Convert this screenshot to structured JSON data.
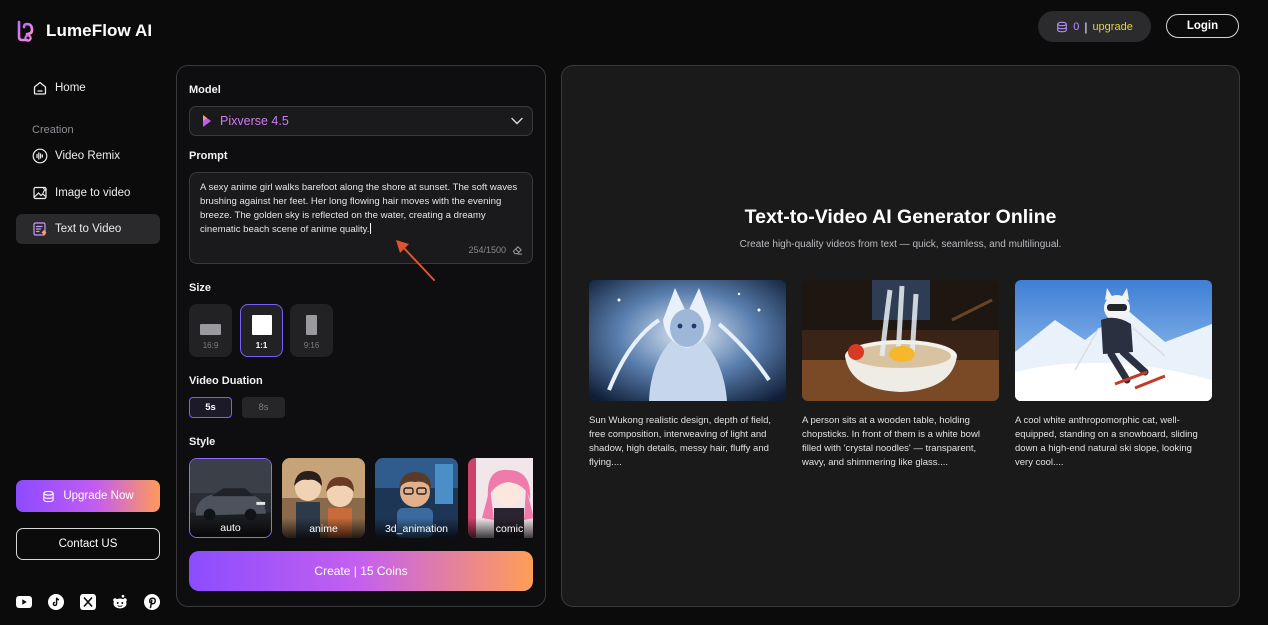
{
  "brand": {
    "name": "LumeFlow AI"
  },
  "sidebar": {
    "home": "Home",
    "section_label": "Creation",
    "items": [
      {
        "label": "Video Remix",
        "icon": "waveform-icon"
      },
      {
        "label": "Image to video",
        "icon": "image-icon"
      },
      {
        "label": "Text to Video",
        "icon": "text-document-icon",
        "active": true
      }
    ],
    "upgrade_now": "Upgrade Now",
    "contact_us": "Contact US",
    "socials": [
      "youtube-icon",
      "tiktok-icon",
      "x-icon",
      "reddit-icon",
      "pinterest-icon"
    ]
  },
  "topbar": {
    "coins": "0",
    "separator": "|",
    "upgrade": "upgrade",
    "login": "Login"
  },
  "form": {
    "model_label": "Model",
    "model_value": "Pixverse 4.5",
    "prompt_label": "Prompt",
    "prompt_text": "A sexy anime girl walks barefoot along the shore at sunset. The soft waves brushing against her feet. Her long flowing hair moves with the evening breeze. The golden sky is reflected on the water, creating a dreamy cinematic beach scene of anime quality.",
    "char_count": "254/1500",
    "size_label": "Size",
    "sizes": [
      {
        "label": "16:9",
        "selected": false
      },
      {
        "label": "1:1",
        "selected": true
      },
      {
        "label": "9:16",
        "selected": false
      }
    ],
    "duration_label": "Video Duation",
    "durations": [
      {
        "label": "5s",
        "selected": true
      },
      {
        "label": "8s",
        "selected": false
      }
    ],
    "style_label": "Style",
    "styles": [
      {
        "label": "auto",
        "selected": true
      },
      {
        "label": "anime",
        "selected": false
      },
      {
        "label": "3d_animation",
        "selected": false
      },
      {
        "label": "comic",
        "selected": false
      }
    ],
    "create_button": "Create | 15 Coins"
  },
  "hero": {
    "title": "Text-to-Video AI Generator Online",
    "subtitle": "Create high-quality videos from text — quick, seamless, and multilingual.",
    "examples": [
      {
        "caption": "Sun Wukong realistic design, depth of field, free composition, interweaving of light and shadow, high details, messy hair, fluffy and flying...."
      },
      {
        "caption": "A person sits at a wooden table, holding chopsticks. In front of them is a white bowl filled with 'crystal noodles' — transparent, wavy, and shimmering like glass...."
      },
      {
        "caption": "A cool white anthropomorphic cat, well-equipped, standing on a snowboard, sliding down a high-end natural ski slope, looking very cool...."
      }
    ]
  },
  "colors": {
    "background": "#0b0b0c",
    "panel_border": "#3a3a3d",
    "accent_purple": "#8b4dff",
    "accent_orange": "#ff9e56",
    "model_text": "#cf7bf0",
    "upgrade_link": "#e2d33b"
  }
}
